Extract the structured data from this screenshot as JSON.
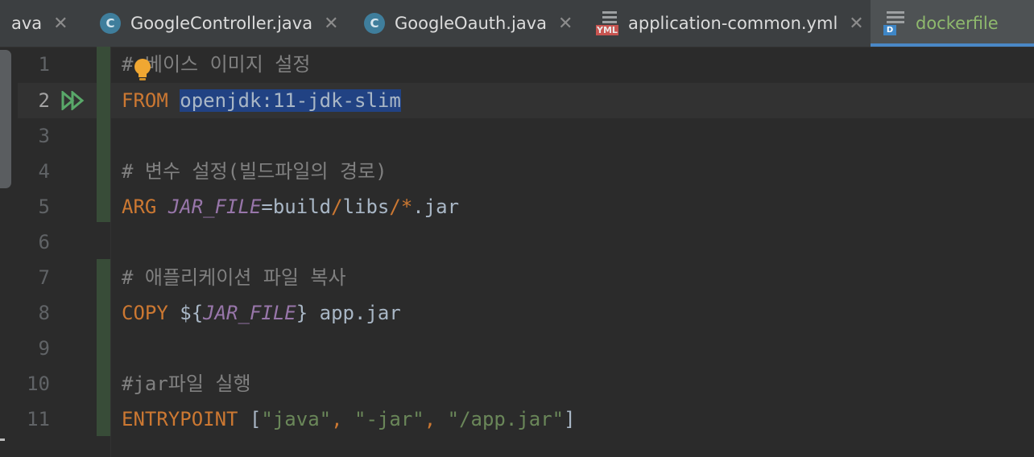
{
  "tabs": [
    {
      "name": "ava",
      "icon": "none",
      "active": false
    },
    {
      "name": "GoogleController.java",
      "icon": "class-c-icon",
      "active": false
    },
    {
      "name": "GoogleOauth.java",
      "icon": "class-c-icon",
      "active": false
    },
    {
      "name": "application-common.yml",
      "icon": "yml-file-icon",
      "active": false
    },
    {
      "name": "dockerfile",
      "icon": "docker-file-icon",
      "active": true
    }
  ],
  "tab_icons": {
    "class_letter": "C",
    "yml_label": "YML",
    "docker_label": "D",
    "close_glyph": "✕"
  },
  "editor": {
    "line_numbers": [
      "1",
      "2",
      "3",
      "4",
      "5",
      "6",
      "7",
      "8",
      "9",
      "10",
      "11"
    ],
    "current_line": 2,
    "lines": {
      "l1_comment": "# 베이스 이미지 설정",
      "l2_keyword": "FROM",
      "l2_image": "openjdk:11-jdk-slim",
      "l4_comment": "# 변수 설정(빌드파일의 경로)",
      "l5_keyword": "ARG",
      "l5_var": "JAR_FILE",
      "l5_eq": "=",
      "l5_p1": "build",
      "l5_slash1": "/",
      "l5_p2": "libs",
      "l5_slash2": "/",
      "l5_star": "*",
      "l5_ext": ".jar",
      "l7_comment": "# 애플리케이션 파일 복사",
      "l8_keyword": "COPY",
      "l8_open": "${",
      "l8_var": "JAR_FILE",
      "l8_close": "}",
      "l8_dest": "app.jar",
      "l10_comment": "#jar파일 실행",
      "l11_keyword": "ENTRYPOINT",
      "l11_lb": "[",
      "l11_s1": "\"java\"",
      "l11_c1": ",",
      "l11_s2": "\"-jar\"",
      "l11_c2": ",",
      "l11_s3": "\"/app.jar\"",
      "l11_rb": "]"
    }
  },
  "colors": {
    "background": "#2b2b2b",
    "keyword": "#cc7832",
    "comment": "#808080",
    "variable": "#9876aa",
    "string": "#6a8759",
    "selection": "#214283",
    "active_tab_text": "#8fb96d",
    "active_tab_underline": "#4a88c7"
  }
}
